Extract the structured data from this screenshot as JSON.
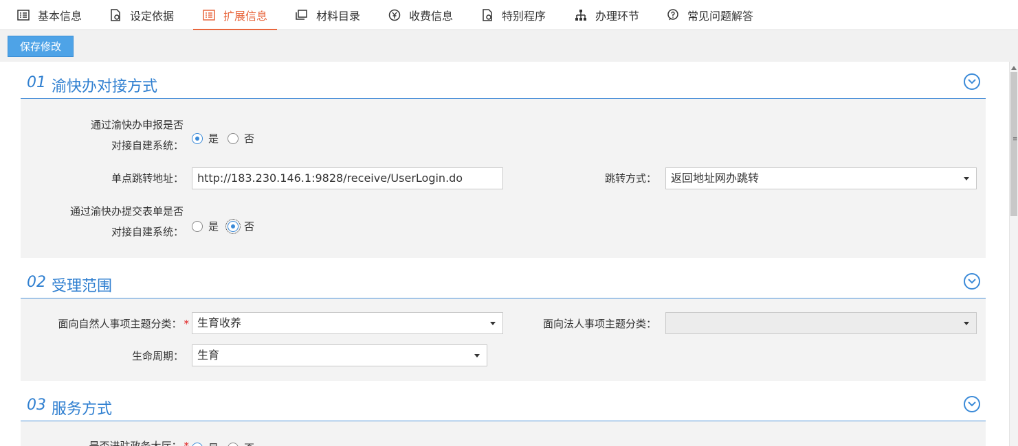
{
  "tabs": [
    {
      "label": "基本信息",
      "icon": "list-icon"
    },
    {
      "label": "设定依据",
      "icon": "document-gear-icon"
    },
    {
      "label": "扩展信息",
      "icon": "list-icon",
      "active": true
    },
    {
      "label": "材料目录",
      "icon": "stack-icon"
    },
    {
      "label": "收费信息",
      "icon": "yen-icon"
    },
    {
      "label": "特别程序",
      "icon": "document-gear-icon"
    },
    {
      "label": "办理环节",
      "icon": "hierarchy-icon"
    },
    {
      "label": "常见问题解答",
      "icon": "chat-question-icon"
    }
  ],
  "toolbar": {
    "save_label": "保存修改"
  },
  "section1": {
    "num": "01",
    "title": "渝快办对接方式",
    "q1_label_line1": "通过渝快办申报是否",
    "q1_label_line2": "对接自建系统：",
    "q1_yes": "是",
    "q1_no": "否",
    "q1_selected": "是",
    "url_label": "单点跳转地址：",
    "url_value": "http://183.230.146.1:9828/receive/UserLogin.do",
    "jump_label": "跳转方式：",
    "jump_value": "返回地址网办跳转",
    "q2_label_line1": "通过渝快办提交表单是否",
    "q2_label_line2": "对接自建系统：",
    "q2_yes": "是",
    "q2_no": "否",
    "q2_selected": "否"
  },
  "section2": {
    "num": "02",
    "title": "受理范围",
    "natural_label": "面向自然人事项主题分类：",
    "natural_value": "生育收养",
    "legal_label": "面向法人事项主题分类：",
    "legal_value": "",
    "life_label": "生命周期：",
    "life_value": "生育"
  },
  "section3": {
    "num": "03",
    "title": "服务方式",
    "q_label": "是否进驻政务大厅：",
    "yes": "是",
    "no": "否"
  },
  "colors": {
    "accent": "#2f7fd0",
    "active_tab": "#e8663d",
    "button": "#4ea3e7",
    "required": "#e02020"
  }
}
